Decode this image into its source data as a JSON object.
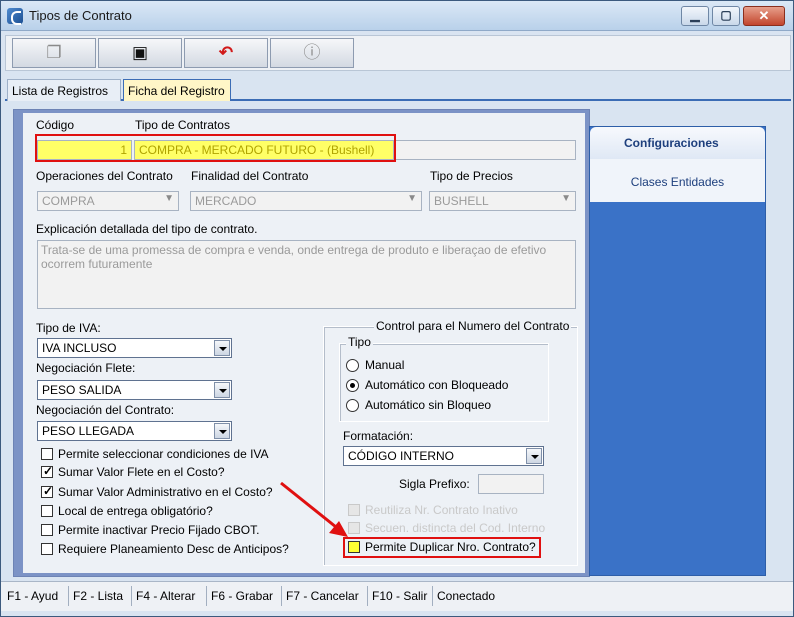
{
  "window": {
    "title": "Tipos de Contrato"
  },
  "toolbar": {
    "buttons": [
      {
        "name": "copy",
        "icon": "document-copy-icon"
      },
      {
        "name": "save",
        "icon": "floppy-disk-icon"
      },
      {
        "name": "undo",
        "icon": "undo-arrow-icon"
      },
      {
        "name": "info",
        "icon": "info-icon"
      }
    ]
  },
  "tabs": [
    {
      "label": "Lista de Registros"
    },
    {
      "label": "Ficha del Registro"
    }
  ],
  "form": {
    "codigo_label": "Código",
    "codigo_value": "1",
    "tipo_contratos_label": "Tipo de Contratos",
    "tipo_contratos_value": "COMPRA - MERCADO FUTURO - (Bushell)",
    "operaciones_label": "Operaciones del Contrato",
    "operaciones_value": "COMPRA",
    "finalidad_label": "Finalidad del Contrato",
    "finalidad_value": "MERCADO",
    "tipo_precios_label": "Tipo de Precios",
    "tipo_precios_value": "BUSHELL",
    "explicacion_label": "Explicación detallada del tipo de contrato.",
    "explicacion_value": "Trata-se de uma promessa de compra e venda, onde entrega de produto e liberaçao de efetivo ocorrem futuramente",
    "tipo_iva_label": "Tipo de IVA:",
    "tipo_iva_value": "IVA INCLUSO",
    "neg_flete_label": "Negociación Flete:",
    "neg_flete_value": "PESO SALIDA",
    "neg_contrato_label": "Negociación del Contrato:",
    "neg_contrato_value": "PESO LLEGADA",
    "checks": [
      {
        "label": "Permite seleccionar condiciones de IVA",
        "checked": false
      },
      {
        "label": "Sumar Valor Flete en el Costo?",
        "checked": true
      },
      {
        "label": "Sumar Valor Administrativo en el Costo?",
        "checked": true
      },
      {
        "label": "Local de entrega obligatório?",
        "checked": false
      },
      {
        "label": "Permite inactivar Precio Fijado CBOT.",
        "checked": false
      },
      {
        "label": "Requiere Planeamiento Desc de Anticipos?",
        "checked": false
      }
    ],
    "control_title": "Control para el Numero del Contrato",
    "tipo_group_label": "Tipo",
    "radios": [
      {
        "label": "Manual",
        "selected": false
      },
      {
        "label": "Automático con Bloqueado",
        "selected": true
      },
      {
        "label": "Automático sin Bloqueo",
        "selected": false
      }
    ],
    "formatacion_label": "Formatación:",
    "formatacion_value": "CÓDIGO INTERNO",
    "sigla_label": "Sigla Prefixo:",
    "sigla_value": "",
    "control_checks": [
      {
        "label": "Reutiliza Nr. Contrato Inativo",
        "checked": false,
        "disabled": true
      },
      {
        "label": "Secuen. distincta del Cod. Interno",
        "checked": false,
        "disabled": true
      },
      {
        "label": "Permite Duplicar Nro. Contrato?",
        "checked": false,
        "disabled": false
      }
    ]
  },
  "side_panel": {
    "header": "Configuraciones",
    "item": "Clases Entidades"
  },
  "status_bar": {
    "items": [
      "F1 - Ayud",
      "F2 - Lista",
      "F4 - Alterar",
      "F6 - Grabar",
      "F7 - Cancelar",
      "F10 - Salir",
      "Conectado"
    ]
  },
  "colors": {
    "highlight": "#ffff66",
    "annotation_red": "#e01010",
    "side_panel_blue": "#3a72c7"
  }
}
